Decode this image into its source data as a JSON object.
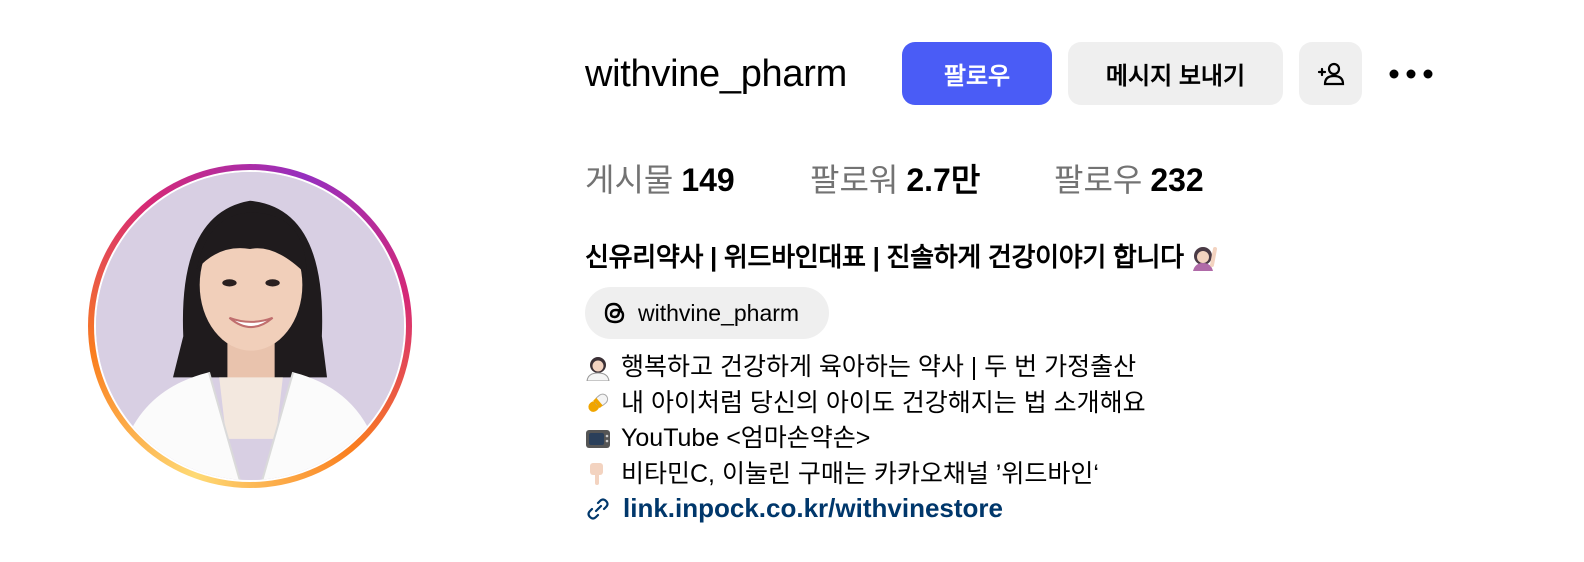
{
  "profile": {
    "username": "withvine_pharm",
    "follow_label": "팔로우",
    "message_label": "메시지 보내기"
  },
  "stats": {
    "posts_label": "게시물",
    "posts_value": "149",
    "followers_label": "팔로워",
    "followers_value": "2.7만",
    "following_label": "팔로우",
    "following_value": "232"
  },
  "bio": {
    "name_line": "신유리약사 | 위드바인대표 | 진솔하게 건강이야기 합니다",
    "threads_handle": "withvine_pharm",
    "lines": [
      "행복하고 건강하게 육아하는 약사 | 두 번 가정출산",
      "내 아이처럼 당신의 아이도 건강해지는 법 소개해요",
      "YouTube <엄마손약손>",
      "비타민C, 이눌린 구매는 카카오채널 ’위드바인‘"
    ],
    "link": "link.inpock.co.kr/withvinestore"
  },
  "icons": {
    "add_user": "add-person-icon",
    "more": "more-horizontal-icon",
    "threads": "threads-icon",
    "link": "link-icon"
  },
  "colors": {
    "follow_button": "#4a5cf6",
    "secondary_button": "#efefef",
    "link": "#00376b",
    "muted": "#737373"
  }
}
